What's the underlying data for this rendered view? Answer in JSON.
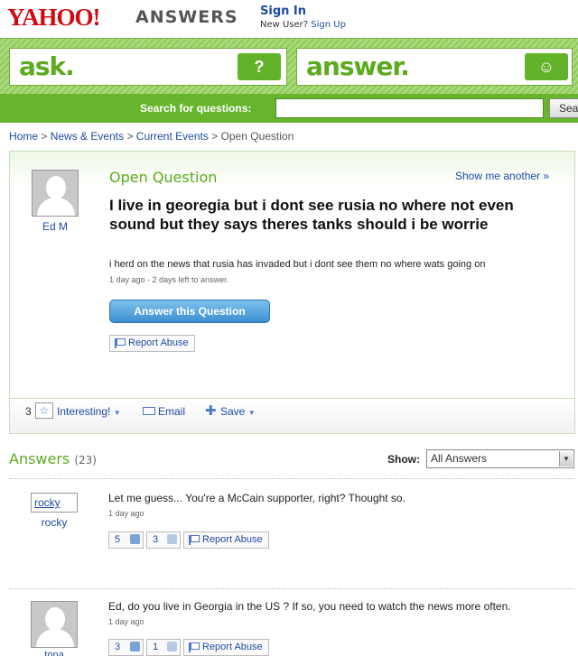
{
  "header": {
    "logo": "YAHOO!",
    "logo_sub": "ANSWERS",
    "sign_in": "Sign In",
    "new_user": "New User?",
    "sign_up": "Sign Up"
  },
  "ask_band": {
    "ask_label": "ask.",
    "ask_badge": "?",
    "answer_label": "answer.",
    "answer_badge": "☺"
  },
  "search": {
    "label": "Search for questions:",
    "value": "",
    "button_label": "Sea"
  },
  "breadcrumb": {
    "items": [
      "Home",
      "News & Events",
      "Current Events",
      "Open Question"
    ],
    "separator": ">"
  },
  "question": {
    "user": "Ed M",
    "status": "Open Question",
    "show_another": "Show me another »",
    "title": "I live in georegia but i dont see rusia no where not even sound but they says theres tanks should i be worrie",
    "detail": "i herd on the news that rusia has invaded but i dont see them no where wats going on",
    "meta": "1 day ago - 2 days left to answer.",
    "answer_button": "Answer this Question",
    "report": "Report Abuse",
    "interesting_count": "3",
    "interesting_label": "Interesting!",
    "email_label": "Email",
    "save_label": "Save"
  },
  "answers": {
    "heading": "Answers",
    "count": "(23)",
    "show_label": "Show:",
    "show_value": "All Answers",
    "items": [
      {
        "avatar_text": "rocky",
        "user": "rocky",
        "text": "Let me guess... You're a McCain supporter, right? Thought so.",
        "meta": "1 day ago",
        "up": "5",
        "down": "3",
        "report": "Report Abuse"
      },
      {
        "user": "tona",
        "text": "Ed, do you live in Georgia in the US ? If so, you need to watch the news more often.",
        "meta": "1 day ago",
        "up": "3",
        "down": "1",
        "report": "Report Abuse"
      }
    ]
  },
  "colors": {
    "yahoo_red": "#d10a10",
    "answers_green": "#5cab1f",
    "link_blue": "#1f4ba5",
    "button_blue": "#3c8fd1"
  }
}
